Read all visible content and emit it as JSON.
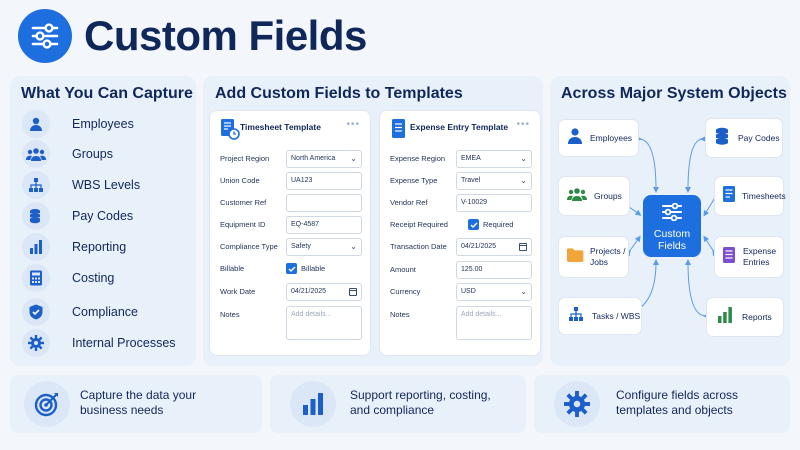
{
  "header": {
    "title": "Custom Fields",
    "icon": "sliders-icon",
    "accent": "#1d6fe0"
  },
  "capture": {
    "title": "What You Can Capture",
    "items": [
      {
        "label": "Employees",
        "icon": "person-icon"
      },
      {
        "label": "Groups",
        "icon": "group-icon"
      },
      {
        "label": "WBS Levels",
        "icon": "hierarchy-icon"
      },
      {
        "label": "Pay Codes",
        "icon": "coins-icon"
      },
      {
        "label": "Reporting",
        "icon": "bar-chart-icon"
      },
      {
        "label": "Costing",
        "icon": "calculator-icon"
      },
      {
        "label": "Compliance",
        "icon": "shield-check-icon"
      },
      {
        "label": "Internal Processes",
        "icon": "gear-icon"
      }
    ]
  },
  "templates": {
    "title": "Add Custom Fields to Templates",
    "timesheet": {
      "title": "Timesheet Template",
      "dots": "•••",
      "fields": [
        {
          "label": "Project Region",
          "value": "North America",
          "kind": "select"
        },
        {
          "label": "Union Code",
          "value": "UA123",
          "kind": "text"
        },
        {
          "label": "Customer Ref",
          "value": "",
          "kind": "text"
        },
        {
          "label": "Equipment ID",
          "value": "EQ-4587",
          "kind": "text"
        },
        {
          "label": "Compliance Type",
          "value": "Safety",
          "kind": "select"
        },
        {
          "label": "Billable",
          "value": "Billable",
          "kind": "checkbox"
        },
        {
          "label": "Work Date",
          "value": "04/21/2025",
          "kind": "date"
        },
        {
          "label": "Notes",
          "placeholder": "Add details...",
          "kind": "area"
        }
      ]
    },
    "expense": {
      "title": "Expense Entry Template",
      "dots": "•••",
      "fields": [
        {
          "label": "Expense Region",
          "value": "EMEA",
          "kind": "select"
        },
        {
          "label": "Expense Type",
          "value": "Travel",
          "kind": "select"
        },
        {
          "label": "Vendor Ref",
          "value": "V-10029",
          "kind": "text"
        },
        {
          "label": "Receipt Required",
          "value": "Required",
          "kind": "checkbox"
        },
        {
          "label": "Transaction Date",
          "value": "04/21/2025",
          "kind": "date"
        },
        {
          "label": "Amount",
          "value": "125.00",
          "kind": "text"
        },
        {
          "label": "Currency",
          "value": "USD",
          "kind": "select"
        },
        {
          "label": "Notes",
          "placeholder": "Add details...",
          "kind": "area"
        }
      ]
    }
  },
  "objects": {
    "title": "Across Major System Objects",
    "hub": {
      "line1": "Custom",
      "line2": "Fields"
    },
    "items": [
      {
        "label": "Employees",
        "icon": "person-icon"
      },
      {
        "label": "Pay Codes",
        "icon": "coins-icon"
      },
      {
        "label": "Groups",
        "icon": "group-icon"
      },
      {
        "label": "Timesheets",
        "icon": "document-icon"
      },
      {
        "label": "Projects /",
        "label2": "Jobs",
        "icon": "folder-icon"
      },
      {
        "label": "Expense",
        "label2": "Entries",
        "icon": "receipt-icon"
      },
      {
        "label": "Tasks / WBS",
        "icon": "hierarchy-icon"
      },
      {
        "label": "Reports",
        "icon": "bar-chart-icon"
      }
    ]
  },
  "benefits": [
    {
      "line1": "Capture the data your",
      "line2": "business needs",
      "icon": "target-icon"
    },
    {
      "line1": "Support reporting, costing,",
      "line2": "and compliance",
      "icon": "bar-chart-icon"
    },
    {
      "line1": "Configure fields across",
      "line2": "templates and objects",
      "icon": "gear-icon"
    }
  ]
}
